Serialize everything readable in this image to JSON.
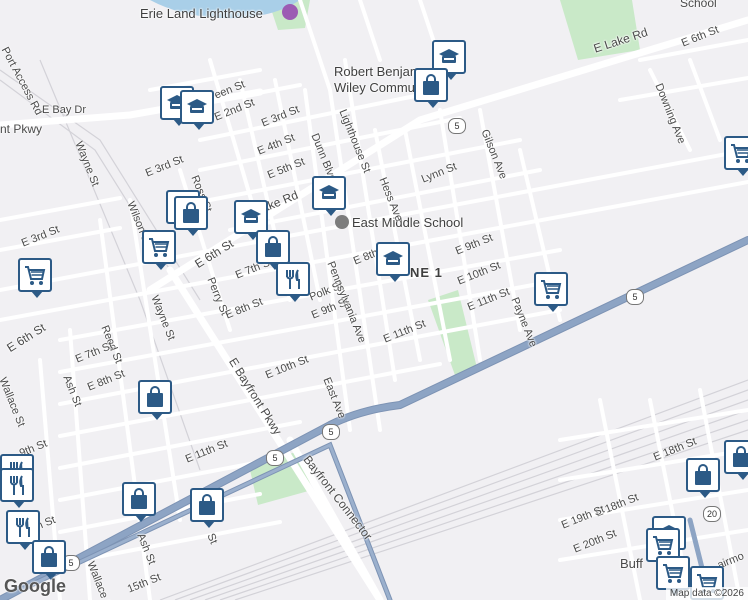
{
  "colors": {
    "background": "#f1f0f3",
    "street": "#ffffff",
    "highway": "#8da4c4",
    "park": "#c9e9c8",
    "pin": "#2c5a86",
    "rail": "#cfcfd4"
  },
  "map": {
    "pois": {
      "lighthouse": "Erie Land Lighthouse",
      "robert_wiley_1": "Robert Benjam",
      "robert_wiley_2": "Wiley Commun",
      "east_middle": "East Middle School",
      "zone": "NE 1"
    },
    "routes": {
      "r1": "5",
      "r2": "5",
      "r3": "5",
      "r4": "5",
      "r5": "5",
      "r6": "20"
    },
    "streets": {
      "port_access": "Port Access Rd",
      "e_bay": "E Bay Dr",
      "pkwy_top": "nt Pkwy",
      "wayne_top": "Wayne St",
      "e_3rd_w": "E 3rd St",
      "e_3rd_far": "E 3rd St",
      "wilson": "Wilson St",
      "ross": "Ross St",
      "queen": "een St",
      "e_2nd": "E 2nd St",
      "e_3rd_mid": "E 3rd St",
      "e_4th": "E 4th St",
      "e_5th": "E 5th St",
      "dunn": "Dunn Blvd",
      "lighthouse_st": "Lighthouse St",
      "lake_rd_mid": "Lake Rd",
      "e_lake_rd": "E Lake Rd",
      "hess": "Hess Ave",
      "lynn": "Lynn St",
      "gilson": "Gilson Ave",
      "e_6th_right": "E 6th St",
      "downing": "Downing Ave",
      "school_top": "School",
      "e_6th_main": "E 6th St",
      "e_6th_left": "E 6th St",
      "e_7th": "E 7th St",
      "perry": "Perry St",
      "e_8th_a": "E 8th",
      "e_8th_b": "E 8th St",
      "e_9th_a": "E 9th St",
      "e_9th_b": "E 9th St",
      "polk": "Polk St",
      "penn": "Pennsylvania Ave",
      "e_10th_a": "E 10th St",
      "e_10th_b": "E 10th St",
      "e_11th_a": "E 11th St",
      "e_11th_b": "E 11th St",
      "e_11th_c": "E 11th St",
      "payne": "Payne Ave",
      "reed": "Reed St",
      "e_7th_w": "E 7th St",
      "e_8th_w": "E 8th St",
      "wallace": "Wallace St",
      "ash": "Ash St",
      "wayne_mid": "Wayne St",
      "east_ave": "East Ave",
      "bayfront_pkwy": "E Bayfront Pkwy",
      "bayfront_conn": "Bayfront Connector",
      "e_9th_sw": "9th St",
      "th_st": "th St",
      "ash_low": "Ash St",
      "wallace_low": "Wallace S",
      "st_low": "St",
      "e_15th": "15th St",
      "e_18th_a": "E 18th St",
      "e_18th_b": "E 18th St",
      "e_19th": "E 19th St",
      "e_20th": "E 20th St",
      "buff": "Buff",
      "fairmo": "airmo"
    },
    "pins": [
      {
        "name": "school-icon",
        "kind": "school"
      },
      {
        "name": "shopping-bag-icon",
        "kind": "bag"
      },
      {
        "name": "school-icon",
        "kind": "school"
      },
      {
        "name": "school-icon",
        "kind": "school"
      },
      {
        "name": "shopping-cart-icon",
        "kind": "cart"
      },
      {
        "name": "shopping-bag-icon",
        "kind": "bag"
      },
      {
        "name": "shopping-bag-icon",
        "kind": "bag"
      },
      {
        "name": "school-icon",
        "kind": "school"
      },
      {
        "name": "school-icon",
        "kind": "school"
      },
      {
        "name": "shopping-cart-icon",
        "kind": "cart"
      },
      {
        "name": "shopping-bag-icon",
        "kind": "bag"
      },
      {
        "name": "restaurant-icon",
        "kind": "food"
      },
      {
        "name": "school-icon",
        "kind": "school"
      },
      {
        "name": "shopping-cart-icon",
        "kind": "cart"
      },
      {
        "name": "shopping-cart-icon",
        "kind": "cart"
      },
      {
        "name": "shopping-bag-icon",
        "kind": "bag"
      },
      {
        "name": "restaurant-icon",
        "kind": "food"
      },
      {
        "name": "restaurant-icon",
        "kind": "food"
      },
      {
        "name": "restaurant-icon",
        "kind": "food"
      },
      {
        "name": "shopping-bag-icon",
        "kind": "bag"
      },
      {
        "name": "shopping-bag-icon",
        "kind": "bag"
      },
      {
        "name": "shopping-bag-icon",
        "kind": "bag"
      },
      {
        "name": "shopping-bag-icon",
        "kind": "bag"
      },
      {
        "name": "shopping-bag-icon",
        "kind": "bag"
      },
      {
        "name": "school-icon",
        "kind": "school"
      },
      {
        "name": "shopping-cart-icon",
        "kind": "cart"
      },
      {
        "name": "shopping-cart-icon",
        "kind": "cart"
      },
      {
        "name": "shopping-cart-icon",
        "kind": "cart"
      }
    ],
    "google_logo": "Google",
    "attribution": "Map data ©2026"
  }
}
